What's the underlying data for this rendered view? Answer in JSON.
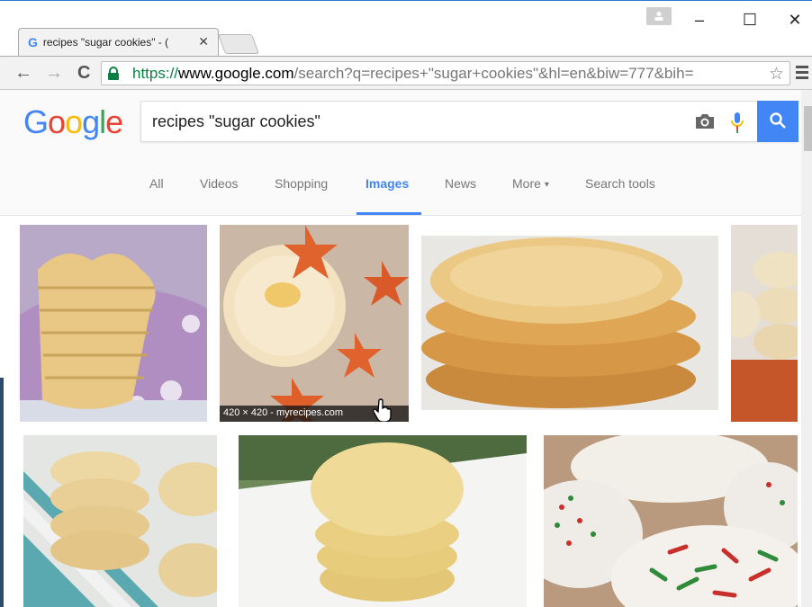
{
  "browser": {
    "tab_title": "recipes \"sugar cookies\" - (",
    "tab_favicon": "G",
    "tab_close": "✕",
    "url_scheme": "https://",
    "url_host": "www.google.com",
    "url_path": "/search?q=recipes+\"sugar+cookies\"&hl=en&biw=777&bih=",
    "window_controls": {
      "minimize": "–",
      "maximize": "☐",
      "close": "✕"
    },
    "nav": {
      "back": "←",
      "forward": "→",
      "reload": "C"
    },
    "bookmark_icon": "☆"
  },
  "google": {
    "logo": {
      "g1": "G",
      "o1": "o",
      "o2": "o",
      "g2": "g",
      "l": "l",
      "e": "e"
    },
    "search_value": "recipes \"sugar cookies\"",
    "tabs": [
      {
        "label": "All"
      },
      {
        "label": "Videos"
      },
      {
        "label": "Shopping"
      },
      {
        "label": "Images"
      },
      {
        "label": "News"
      },
      {
        "label": "More"
      },
      {
        "label": "Search tools"
      }
    ],
    "active_tab": "Images",
    "more_caret": "▾"
  },
  "results": {
    "hover_caption": "420 × 420 - myrecipes.com"
  },
  "colors": {
    "accent": "#4285f4",
    "secure_green": "#0b8043"
  }
}
